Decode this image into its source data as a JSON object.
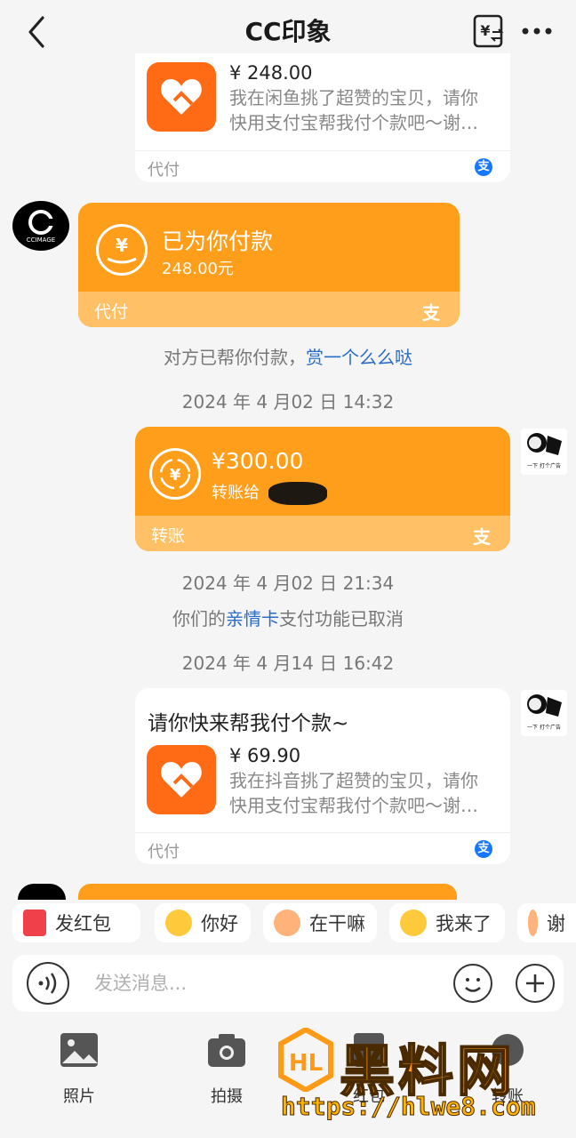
{
  "header": {
    "title": "CC印象"
  },
  "messages": {
    "top_card": {
      "price": "¥ 248.00",
      "desc_line1": "我在闲鱼挑了超赞的宝贝，请你",
      "desc_line2": "快用支付宝帮我付个款吧～谢…",
      "footer": "代付",
      "badge": "支"
    },
    "paid_card": {
      "title": "已为你付款",
      "amount": "248.00元",
      "footer": "代付",
      "badge": "支"
    },
    "sys1_prefix": "对方已帮你付款，",
    "sys1_link": "赏一个么么哒",
    "time1": "2024 年 4 月02 日 14:32",
    "transfer_card": {
      "amount": "¥300.00",
      "to": "转账给",
      "footer": "转账",
      "badge": "支"
    },
    "time2": "2024 年 4 月02 日 21:34",
    "sys2_prefix": "你们的",
    "sys2_link": "亲情卡",
    "sys2_suffix": "支付功能已取消",
    "time3": "2024 年 4 月14 日 16:42",
    "request_card": {
      "title": "请你快来帮我付个款~",
      "price": "¥ 69.90",
      "desc_line1": "我在抖音挑了超赞的宝贝，请你",
      "desc_line2": "快用支付宝帮我付个款吧～谢…",
      "footer": "代付",
      "badge": "支"
    }
  },
  "quick_replies": [
    "发红包",
    "你好",
    "在干嘛",
    "我来了",
    "谢"
  ],
  "input": {
    "placeholder": "发送消息..."
  },
  "toolbar": {
    "photo": "照片",
    "camera": "拍摄",
    "redpacket": "红包",
    "transfer": "转账"
  },
  "watermark": {
    "text": "黑料网",
    "url": "https://hlwe8.com"
  },
  "colors": {
    "orange": "#ff9e1b",
    "orange_light": "#ffc066",
    "link": "#2a6cc9",
    "alipay_blue": "#1677ff",
    "app_orange": "#ff6a15"
  }
}
